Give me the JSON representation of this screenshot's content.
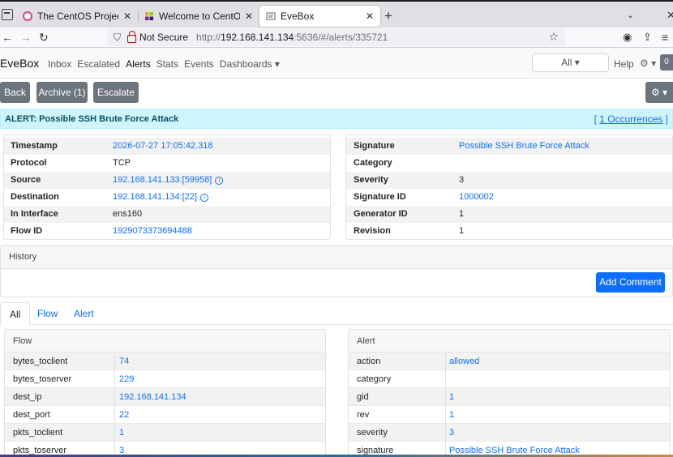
{
  "browser": {
    "tabs": [
      {
        "title": "The CentOS Project",
        "active": false
      },
      {
        "title": "Welcome to CentOS Strea",
        "active": false
      },
      {
        "title": "EveBox",
        "active": true
      }
    ],
    "not_secure": "Not Secure",
    "url_prefix": "http://",
    "url_host": "192.168.141.134",
    "url_rest": ":5636/#/alerts/335721"
  },
  "app": {
    "brand": "EveBox",
    "nav": [
      "Inbox",
      "Escalated",
      "Alerts",
      "Stats",
      "Events",
      "Dashboards ▾"
    ],
    "filter": "All ▾",
    "help": "Help",
    "gear": "⚙ ▾",
    "badge": "0"
  },
  "toolbar": {
    "back": "Back",
    "archive": "Archive (1)",
    "escalate": "Escalate",
    "settings": "⚙ ▾"
  },
  "alert": {
    "title": "ALERT: Possible SSH Brute Force Attack",
    "occ_prefix": "[",
    "occurrences": "1 Occurrences",
    "occ_suffix": "]"
  },
  "left_info": [
    {
      "k": "Timestamp",
      "v": "2026-07-27 17:05:42.318",
      "link": true
    },
    {
      "k": "Protocol",
      "v": "TCP",
      "link": false
    },
    {
      "k": "Source",
      "v": "192.168.141.133:[59958]",
      "link": true,
      "info": true
    },
    {
      "k": "Destination",
      "v": "192.168.141.134:[22]",
      "link": true,
      "info": true
    },
    {
      "k": "In Interface",
      "v": "ens160",
      "link": false
    },
    {
      "k": "Flow ID",
      "v": "1929073373694488",
      "link": true
    }
  ],
  "right_info": [
    {
      "k": "Signature",
      "v": "Possible SSH Brute Force Attack",
      "link": true
    },
    {
      "k": "Category",
      "v": "",
      "link": false
    },
    {
      "k": "Severity",
      "v": "3",
      "link": false
    },
    {
      "k": "Signature ID",
      "v": "1000002",
      "link": true
    },
    {
      "k": "Generator ID",
      "v": "1",
      "link": false
    },
    {
      "k": "Revision",
      "v": "1",
      "link": false
    }
  ],
  "history": {
    "title": "History",
    "add_comment": "Add Comment"
  },
  "tabs": [
    "All",
    "Flow",
    "Alert"
  ],
  "flow": {
    "title": "Flow",
    "rows": [
      {
        "k": "bytes_toclient",
        "v": "74"
      },
      {
        "k": "bytes_toserver",
        "v": "229"
      },
      {
        "k": "dest_ip",
        "v": "192.168.141.134"
      },
      {
        "k": "dest_port",
        "v": "22"
      },
      {
        "k": "pkts_toclient",
        "v": "1"
      },
      {
        "k": "pkts_toserver",
        "v": "3"
      }
    ]
  },
  "alert_card": {
    "title": "Alert",
    "rows": [
      {
        "k": "action",
        "v": "allowed"
      },
      {
        "k": "category",
        "v": ""
      },
      {
        "k": "gid",
        "v": "1"
      },
      {
        "k": "rev",
        "v": "1"
      },
      {
        "k": "severity",
        "v": "3"
      },
      {
        "k": "signature",
        "v": "Possible SSH Brute Force Attack"
      }
    ]
  }
}
